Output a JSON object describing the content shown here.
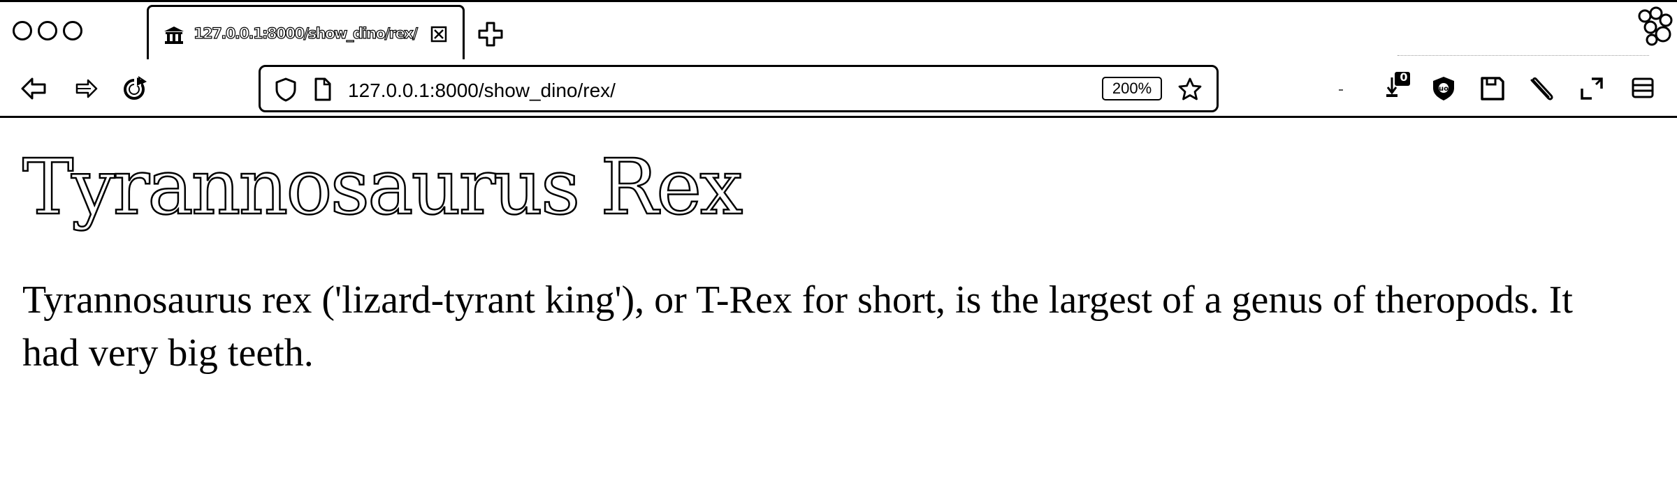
{
  "browser": {
    "tab": {
      "title": "127.0.0.1:8000/show_dino/rex/",
      "favicon": "museum-icon",
      "close_icon": "close-icon"
    },
    "new_tab_icon": "plus-icon",
    "extensions_icon": "hexagon-cluster-icon",
    "window_controls": [
      "close-dot",
      "minimize-dot",
      "zoom-dot"
    ]
  },
  "toolbar": {
    "back_icon": "back-arrow-icon",
    "forward_icon": "forward-arrow-icon",
    "reload_icon": "reload-icon",
    "url": "127.0.0.1:8000/show_dino/rex/",
    "zoom_level": "200%",
    "bookmark_icon": "star-icon",
    "download_badge": "0",
    "right_icons": [
      "download-icon",
      "shield-icon",
      "save-icon",
      "paperclip-icon",
      "resize-icon",
      "menu-icon"
    ]
  },
  "page": {
    "heading": "Tyrannosaurus Rex",
    "paragraph": "Tyrannosaurus rex ('lizard-tyrant king'), or T-Rex for short, is the largest of a genus of theropods. It had very big teeth."
  }
}
